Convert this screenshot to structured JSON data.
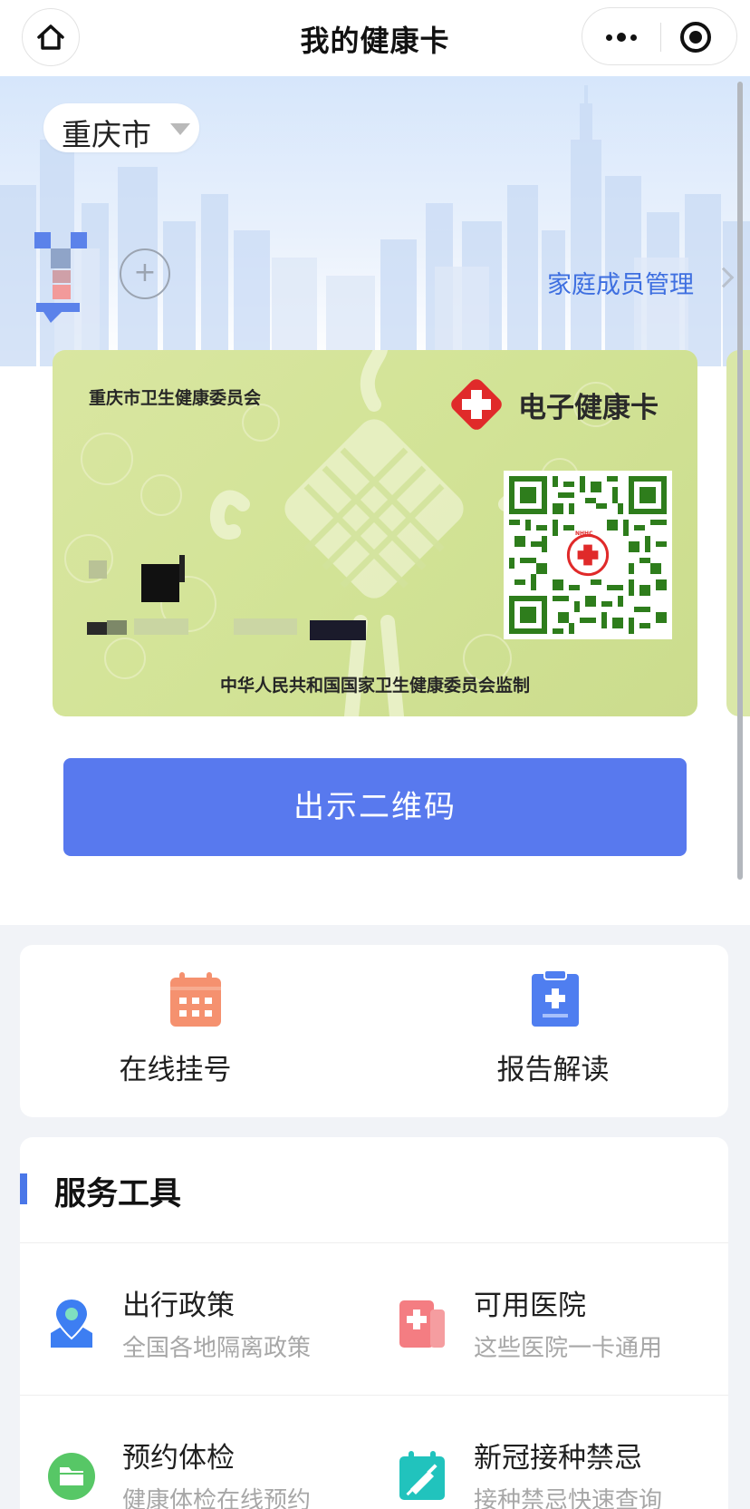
{
  "header": {
    "title": "我的健康卡"
  },
  "city": {
    "name": "重庆市"
  },
  "family": {
    "add_symbol": "+",
    "manage_label": "家庭成员管理"
  },
  "card": {
    "issuer": "重庆市卫生健康委员会",
    "brand": "电子健康卡",
    "qr_badge": "NHHC",
    "footer": "中华人民共和国国家卫生健康委员会监制"
  },
  "actions": {
    "show_qr": "出示二维码"
  },
  "quick_services": [
    {
      "label": "在线挂号",
      "icon": "calendar-icon",
      "color": "#f5916f"
    },
    {
      "label": "报告解读",
      "icon": "clipboard-icon",
      "color": "#4f7ef0"
    }
  ],
  "tools": {
    "title": "服务工具",
    "items": [
      {
        "name": "出行政策",
        "desc": "全国各地隔离政策",
        "icon": "map-pin-icon",
        "color": "#3d7ef2"
      },
      {
        "name": "可用医院",
        "desc": "这些医院一卡通用",
        "icon": "hospital-icon",
        "color": "#f47d82"
      },
      {
        "name": "预约体检",
        "desc": "健康体检在线预约",
        "icon": "folder-icon",
        "color": "#57c766"
      },
      {
        "name": "新冠接种禁忌",
        "desc": "接种禁忌快速查询",
        "icon": "vaccine-calendar-icon",
        "color": "#21c3bd"
      }
    ]
  },
  "colors": {
    "primary": "#5879ee",
    "link": "#3e6fe0",
    "card_green": "#d2e396",
    "qr_green": "#2e7d1c",
    "cross_red": "#e02a2a"
  }
}
